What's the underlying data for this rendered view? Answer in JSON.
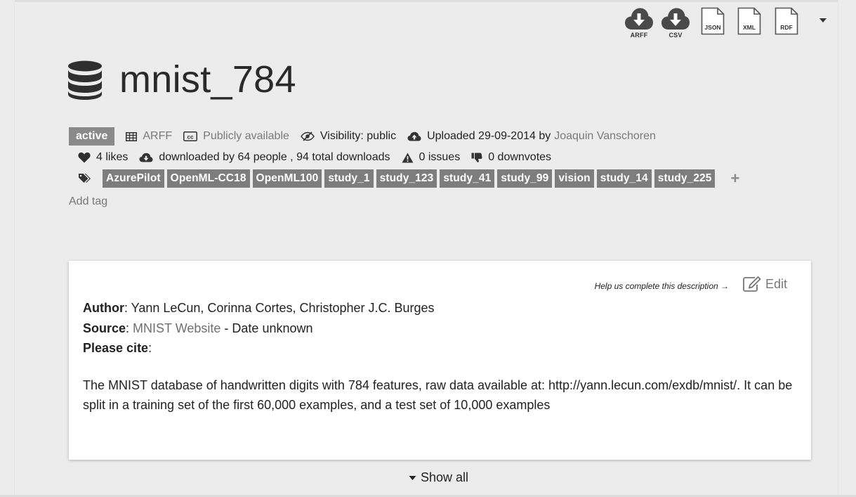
{
  "downloads": [
    {
      "label": "ARFF",
      "icon": "cloud-download-icon"
    },
    {
      "label": "CSV",
      "icon": "cloud-download-icon"
    },
    {
      "label": "JSON",
      "icon": "document-icon"
    },
    {
      "label": "XML",
      "icon": "document-icon"
    },
    {
      "label": "RDF",
      "icon": "document-icon"
    }
  ],
  "dataset": {
    "title": "mnist_784",
    "status": "active",
    "format": "ARFF",
    "license": "Publicly available",
    "visibility": "Visibility: public",
    "uploaded": "Uploaded 29-09-2014 by",
    "uploader": "Joaquin Vanschoren"
  },
  "stats": {
    "likes": "4 likes",
    "downloads": "downloaded by 64 people , 94 total downloads",
    "issues": "0 issues",
    "downvotes": "0 downvotes"
  },
  "tags": [
    "AzurePilot",
    "OpenML-CC18",
    "OpenML100",
    "study_1",
    "study_123",
    "study_41",
    "study_99",
    "vision",
    "study_14",
    "study_225"
  ],
  "add_tag": "Add tag",
  "add_tag_plus": "+",
  "description": {
    "help_text": "Help us complete this description →",
    "edit_label": "Edit",
    "author_label": "Author",
    "author": ": Yann LeCun, Corinna Cortes, Christopher J.C. Burges",
    "source_label": "Source",
    "source_sep": ": ",
    "source_link": "MNIST Website",
    "source_rest": " - Date unknown",
    "cite_label": "Please cite",
    "cite_rest": ":",
    "body": "The MNIST database of handwritten digits with 784 features, raw data available at: http://yann.lecun.com/exdb/mnist/. It can be split in a training set of the first 60,000 examples, and a test set of 10,000 examples"
  },
  "show_all": "Show all"
}
